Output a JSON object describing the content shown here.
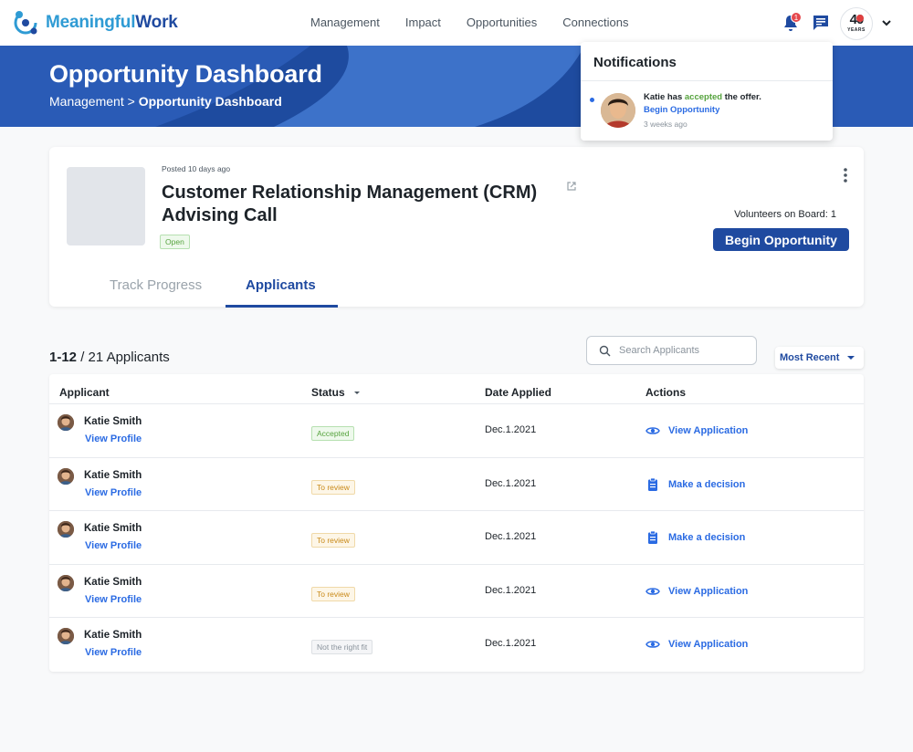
{
  "brand": {
    "name_part1": "Meaningful",
    "name_part2": "Work"
  },
  "nav": [
    "Management",
    "Impact",
    "Opportunities",
    "Connections"
  ],
  "header": {
    "notification_count": "1",
    "anniversary_number": "40",
    "anniversary_label": "YEARS"
  },
  "hero": {
    "title": "Opportunity Dashboard",
    "breadcrumb_parent": "Management",
    "breadcrumb_separator": ">",
    "breadcrumb_current": "Opportunity Dashboard"
  },
  "notifications": {
    "title": "Notifications",
    "items": [
      {
        "name": "Katie",
        "text_before": "has",
        "highlight": "accepted",
        "text_after": "the offer.",
        "link": "Begin Opportunity",
        "time": "3 weeks ago"
      }
    ]
  },
  "opportunity": {
    "posted": "Posted 10 days ago",
    "title": "Customer Relationship Management (CRM) Advising Call",
    "status": "Open",
    "volunteers_label": "Volunteers on Board: 1",
    "begin_button": "Begin Opportunity",
    "tabs": [
      "Track Progress",
      "Applicants"
    ]
  },
  "applicants": {
    "range": "1-12",
    "total": "/ 21 Applicants",
    "search_placeholder": "Search Applicants",
    "sort_label": "Most Recent",
    "columns": [
      "Applicant",
      "Status",
      "Date Applied",
      "Actions"
    ],
    "rows": [
      {
        "name": "Katie Smith",
        "profile_link": "View Profile",
        "status": "Accepted",
        "status_type": "accepted",
        "date": "Dec.1.2021",
        "action": "View Application",
        "action_icon": "eye-icon"
      },
      {
        "name": "Katie Smith",
        "profile_link": "View Profile",
        "status": "To review",
        "status_type": "review",
        "date": "Dec.1.2021",
        "action": "Make a decision",
        "action_icon": "clipboard-icon"
      },
      {
        "name": "Katie Smith",
        "profile_link": "View Profile",
        "status": "To review",
        "status_type": "review",
        "date": "Dec.1.2021",
        "action": "Make a decision",
        "action_icon": "clipboard-icon"
      },
      {
        "name": "Katie Smith",
        "profile_link": "View Profile",
        "status": "To review",
        "status_type": "review",
        "date": "Dec.1.2021",
        "action": "View Application",
        "action_icon": "eye-icon"
      },
      {
        "name": "Katie Smith",
        "profile_link": "View Profile",
        "status": "Not the right fit",
        "status_type": "notfit",
        "date": "Dec.1.2021",
        "action": "View Application",
        "action_icon": "eye-icon"
      }
    ]
  },
  "colors": {
    "primary": "#1f4aa0",
    "link": "#2b6be3",
    "accepted": "#56a33e",
    "review": "#c98a1a",
    "badge_red": "#e5484d"
  }
}
